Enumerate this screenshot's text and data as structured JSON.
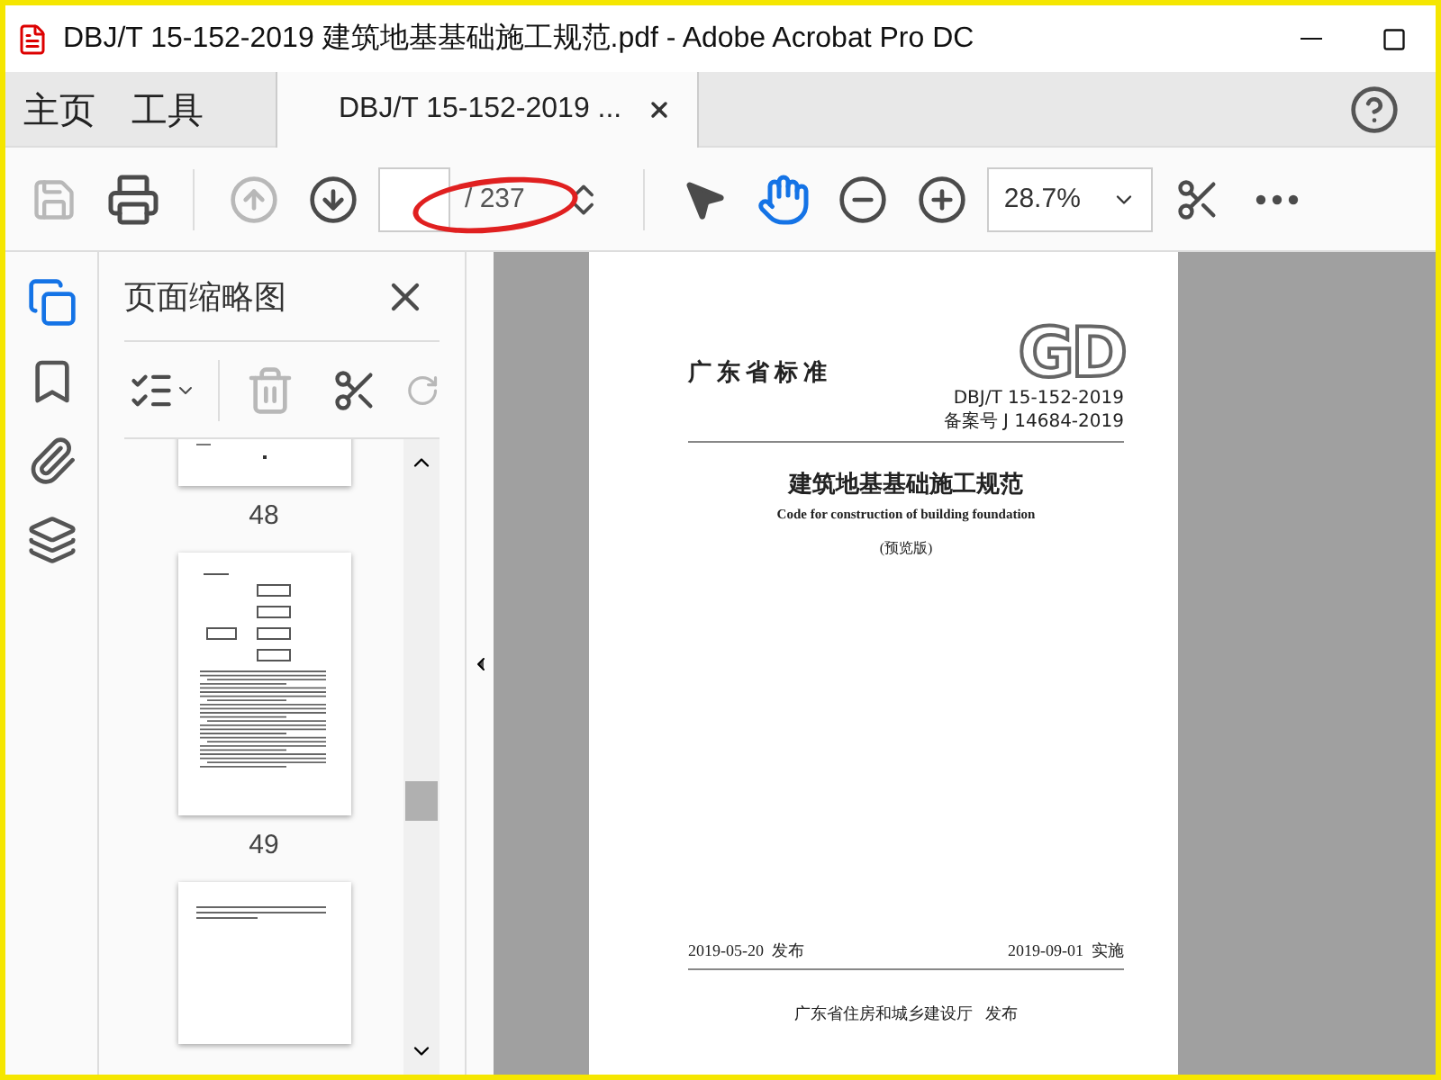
{
  "window": {
    "title": "DBJ/T 15-152-2019 建筑地基基础施工规范.pdf - Adobe Acrobat Pro DC"
  },
  "tabs": [
    {
      "label": "主页",
      "selected": false
    },
    {
      "label": "工具",
      "selected": false
    },
    {
      "label": "DBJ/T 15-152-2019 ...",
      "selected": true,
      "closable": true
    }
  ],
  "toolbar": {
    "save_disabled": true,
    "prev_page_disabled": true,
    "page_total": "/ 237",
    "zoom": "28.7%",
    "tools": [
      {
        "kind": "select",
        "selected": false
      },
      {
        "kind": "hand",
        "selected": true
      }
    ]
  },
  "side_rail": [
    {
      "kind": "pages",
      "selected": true
    },
    {
      "kind": "bookmarks",
      "selected": false
    },
    {
      "kind": "attachments",
      "selected": false
    },
    {
      "kind": "layers",
      "selected": false
    }
  ],
  "thumbnail_panel": {
    "title": "页面缩略图",
    "delete_disabled": true,
    "rotate_disabled": true,
    "thumbnails": [
      {
        "kind": "list-end",
        "label": "48"
      },
      {
        "kind": "flowchart",
        "label": "49"
      },
      {
        "kind": "text"
      }
    ]
  },
  "document_page": {
    "standard_type": "广东省标准",
    "logo": "GD",
    "code": "DBJ/T 15-152-2019",
    "record_number": "备案号 J 14684-2019",
    "title": "建筑地基基础施工规范",
    "english_title": "Code for construction of building foundation",
    "edition": "(预览版)",
    "issue_date": "2019-05-20  发布",
    "effective_date": "2019-09-01  实施",
    "issuer": "广东省住房和城乡建设厅   发布"
  }
}
